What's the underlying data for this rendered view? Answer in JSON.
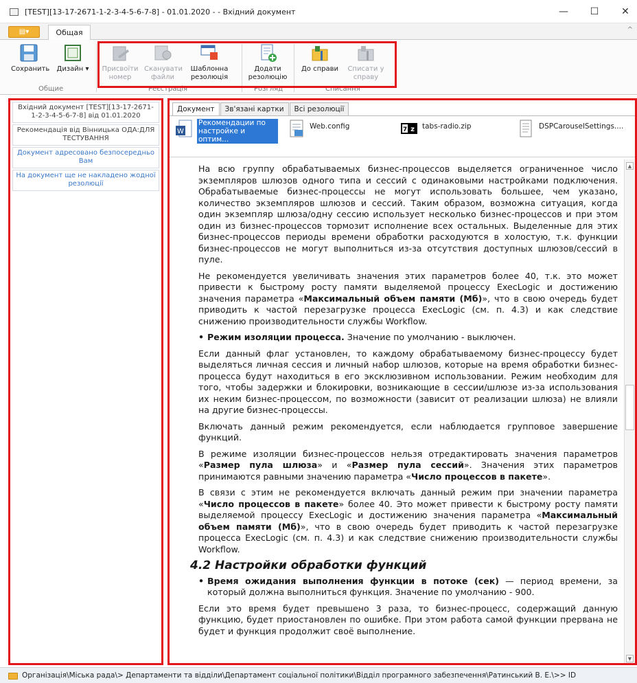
{
  "window": {
    "title": "[TEST][13-17-2671-1-2-3-4-5-6-7-8] - 01.01.2020 - - Вхідний документ",
    "minimize": "—",
    "maximize": "☐",
    "close": "✕"
  },
  "ribbon": {
    "file_tab": "▤▾",
    "active_tab": "Общая",
    "collapse_caret": "^",
    "buttons": [
      {
        "label": "Сохранить",
        "enabled": true,
        "icon": "save-icon"
      },
      {
        "label": "Дизайн ▾",
        "enabled": true,
        "icon": "design-icon"
      },
      {
        "label": "Присвоїти номер",
        "enabled": false,
        "icon": "assign-number-icon"
      },
      {
        "label": "Сканувати файли",
        "enabled": false,
        "icon": "scan-icon"
      },
      {
        "label": "Шаблонна резолюція",
        "enabled": true,
        "icon": "template-resolution-icon"
      },
      {
        "label": "Додати резолюцію",
        "enabled": true,
        "icon": "add-resolution-icon"
      },
      {
        "label": "До справи",
        "enabled": true,
        "icon": "to-case-icon"
      },
      {
        "label": "Списати у справу",
        "enabled": false,
        "icon": "write-off-icon"
      }
    ],
    "groups": [
      "Общие",
      "Реєстрація",
      "Розгляд",
      "Списання"
    ]
  },
  "left_panel": {
    "items": [
      "Вхідний документ [TEST][13-17-2671-1-2-3-4-5-6-7-8] від 01.01.2020",
      "Рекомендація від Вінницька ОДА:ДЛЯ ТЕСТУВАННЯ",
      "Документ адресовано безпосередньо Вам",
      "На документ ще не накладено жодної резолюції"
    ]
  },
  "doc_tabs": [
    "Документ",
    "Зв'язані картки",
    "Всі резолюції"
  ],
  "attachments": [
    {
      "name": "Рекомендации по настройке и оптим...",
      "icon": "word-doc-icon",
      "selected": true
    },
    {
      "name": "Web.config",
      "icon": "config-file-icon",
      "selected": false
    },
    {
      "name": "tabs-radio.zip",
      "icon": "7zip-archive-icon",
      "selected": false
    },
    {
      "name": "DSPCarouselSettings....",
      "icon": "text-file-icon",
      "selected": false
    }
  ],
  "content": {
    "p1": "На всю группу обрабатываемых бизнес-процессов выделяется ограниченное число экземпляров шлюзов одного типа и сессий с одинаковыми настройками подключения. Обрабатываемые бизнес-процессы не могут использовать большее, чем указано, количество экземпляров шлюзов и сессий. Таким образом, возможна ситуация, когда один экземпляр шлюза/одну сессию использует несколько бизнес-процессов и при этом один из бизнес-процессов тормозит исполнение всех остальных. Выделенные для этих бизнес-процессов периоды времени обработки расходуются в холостую, т.к. функции бизнес-процессов не могут выполниться из-за отсутствия доступных шлюзов/сессий в пуле.",
    "p2a": "Не рекомендуется увеличивать значения этих параметров более 40, т.к. это может привести к быстрому росту памяти выделяемой процессу ExecLogic и достижению значения параметра «",
    "p2b": "Максимальный объем памяти (Мб)",
    "p2c": "», что в свою очередь будет приводить к частой перезагрузке процесса ExecLogic (см. п. 4.3) и как следствие снижению производительности службы Workflow.",
    "b1a": "Режим изоляции процесса.",
    "b1b": " Значение по умолчанию - выключен.",
    "p3": "Если данный флаг установлен, то каждому обрабатываемому бизнес-процессу будет выделяться личная сессия и личный набор шлюзов, которые на время обработки бизнес-процесса будут находиться в его эксклюзивном использовании. Режим необходим для того, чтобы задержки и блокировки, возникающие в сессии/шлюзе из-за использования их неким бизнес-процессом, по возможности (зависит от реализации шлюза) не влияли на другие бизнес-процессы.",
    "p4": "Включать данный режим рекомендуется, если наблюдается групповое завершение функций.",
    "p5a": "В режиме изоляции бизнес-процессов нельзя отредактировать значения параметров «",
    "p5b": "Размер пула шлюза",
    "p5c": "» и «",
    "p5d": "Размер пула сессий",
    "p5e": "». Значения этих параметров принимаются равными значению параметра «",
    "p5f": "Число процессов в пакете",
    "p5g": "».",
    "p6a": "В связи с этим не рекомендуется включать данный режим при значении параметра «",
    "p6b": "Число процессов в пакете",
    "p6c": "» более 40. Это может привести к быстрому росту памяти выделяемой процессу ExecLogic и достижению значения параметра «",
    "p6d": "Максимальный объем памяти (Мб)",
    "p6e": "», что в свою очередь будет приводить к частой перезагрузке процесса ExecLogic (см. п. 4.3) и как следствие снижению производительности службы Workflow.",
    "h2": "4.2 Настройки обработки функций",
    "b2a": "Время ожидания выполнения функции в потоке (сек)",
    "b2b": " — период времени, за который должна выполниться функция. Значение по умолчанию - 900.",
    "p7": "Если это время будет превышено 3 раза, то бизнес-процесс, содержащий данную функцию, будет приостановлен по ошибке. При этом работа самой функции прервана не будет и функция продолжит своё выполнение."
  },
  "statusbar": {
    "path": "Організація\\Міська рада\\> Департаменти та відділи\\Департамент соціальної політики\\Відділ програмного забезпечення\\Ратинський В. Е.\\>> ID"
  }
}
